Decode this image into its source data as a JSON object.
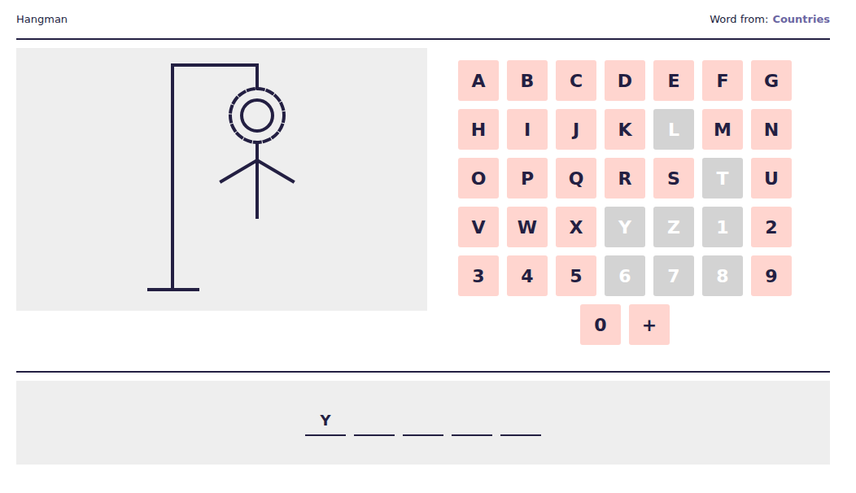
{
  "header": {
    "title": "Hangman",
    "category_label": "Word from:",
    "category": "Countries"
  },
  "figure": {
    "gallows": true,
    "noose": true,
    "head": true,
    "body": true,
    "left_arm": true,
    "right_arm": true,
    "left_leg": false,
    "right_leg": false
  },
  "keys": [
    {
      "label": "A",
      "disabled": false
    },
    {
      "label": "B",
      "disabled": false
    },
    {
      "label": "C",
      "disabled": false
    },
    {
      "label": "D",
      "disabled": false
    },
    {
      "label": "E",
      "disabled": false
    },
    {
      "label": "F",
      "disabled": false
    },
    {
      "label": "G",
      "disabled": false
    },
    {
      "label": "H",
      "disabled": false
    },
    {
      "label": "I",
      "disabled": false
    },
    {
      "label": "J",
      "disabled": false
    },
    {
      "label": "K",
      "disabled": false
    },
    {
      "label": "L",
      "disabled": true
    },
    {
      "label": "M",
      "disabled": false
    },
    {
      "label": "N",
      "disabled": false
    },
    {
      "label": "O",
      "disabled": false
    },
    {
      "label": "P",
      "disabled": false
    },
    {
      "label": "Q",
      "disabled": false
    },
    {
      "label": "R",
      "disabled": false
    },
    {
      "label": "S",
      "disabled": false
    },
    {
      "label": "T",
      "disabled": true
    },
    {
      "label": "U",
      "disabled": false
    },
    {
      "label": "V",
      "disabled": false
    },
    {
      "label": "W",
      "disabled": false
    },
    {
      "label": "X",
      "disabled": false
    },
    {
      "label": "Y",
      "disabled": true
    },
    {
      "label": "Z",
      "disabled": true
    },
    {
      "label": "1",
      "disabled": true
    },
    {
      "label": "2",
      "disabled": false
    },
    {
      "label": "3",
      "disabled": false
    },
    {
      "label": "4",
      "disabled": false
    },
    {
      "label": "5",
      "disabled": false
    },
    {
      "label": "6",
      "disabled": true
    },
    {
      "label": "7",
      "disabled": true
    },
    {
      "label": "8",
      "disabled": true
    },
    {
      "label": "9",
      "disabled": false
    },
    {
      "label": "0",
      "disabled": false
    },
    {
      "label": "+",
      "disabled": false
    }
  ],
  "word": [
    {
      "letter": "Y",
      "revealed": true
    },
    {
      "letter": "",
      "revealed": false
    },
    {
      "letter": "",
      "revealed": false
    },
    {
      "letter": "",
      "revealed": false
    },
    {
      "letter": "",
      "revealed": false
    }
  ]
}
